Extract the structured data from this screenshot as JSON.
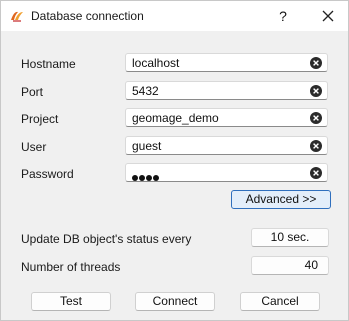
{
  "window": {
    "title": "Database connection",
    "help_label": "?"
  },
  "form": {
    "hostname": {
      "label": "Hostname",
      "value": "localhost"
    },
    "port": {
      "label": "Port",
      "value": "5432"
    },
    "project": {
      "label": "Project",
      "value": "geomage_demo"
    },
    "user": {
      "label": "User",
      "value": "guest"
    },
    "password": {
      "label": "Password",
      "masked_length": 4
    }
  },
  "advanced_label": "Advanced >>",
  "settings": {
    "update_label": "Update DB object's status every",
    "update_value": "10 sec.",
    "threads_label": "Number of threads",
    "threads_value": "40"
  },
  "buttons": {
    "test": "Test",
    "connect": "Connect",
    "cancel": "Cancel"
  },
  "colors": {
    "accent": "#2f6fbd",
    "clear_icon": "#2b2b2b"
  }
}
